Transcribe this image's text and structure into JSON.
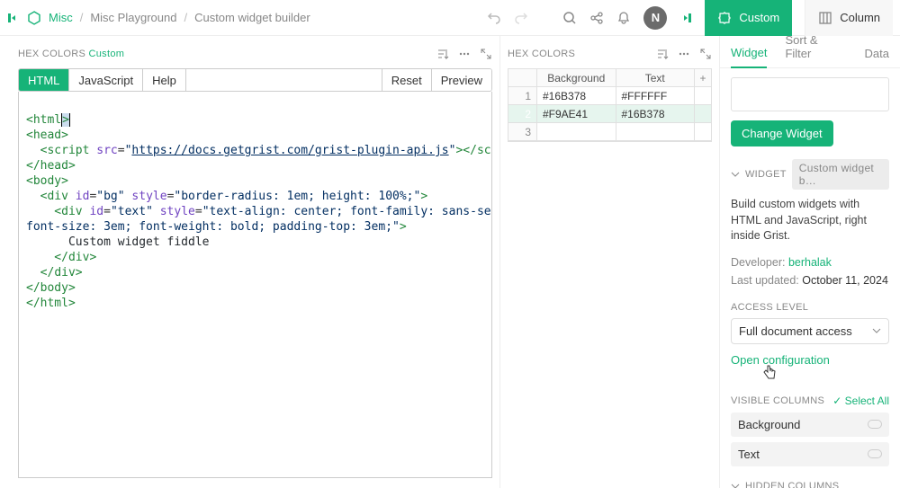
{
  "topbar": {
    "crumb1": "Misc",
    "crumb2": "Misc Playground",
    "crumb3": "Custom widget builder",
    "avatar": "N",
    "custom_label": "Custom",
    "column_label": "Column"
  },
  "editor": {
    "title_main": "HEX COLORS",
    "title_sub": "Custom",
    "tabs": {
      "html": "HTML",
      "js": "JavaScript",
      "help": "Help",
      "reset": "Reset",
      "preview": "Preview"
    },
    "code": {
      "l1a": "<",
      "l1b": "html",
      "l1c": ">",
      "l2a": "<",
      "l2b": "head",
      "l2c": ">",
      "l3a": "  <",
      "l3b": "script",
      "l3c": " ",
      "l3d": "src",
      "l3e": "=",
      "l3f": "\"",
      "l3url": "https://docs.getgrist.com/grist-plugin-api.js",
      "l3g": "\"",
      "l3h": "></",
      "l3i": "script",
      "l3j": ">",
      "l4a": "</",
      "l4b": "head",
      "l4c": ">",
      "l5a": "<",
      "l5b": "body",
      "l5c": ">",
      "l6a": "  <",
      "l6b": "div",
      "l6c": " ",
      "l6d": "id",
      "l6e": "=",
      "l6f": "\"bg\"",
      "l6g": " ",
      "l6h": "style",
      "l6i": "=",
      "l6j": "\"border-radius: 1em; height: 100%;\"",
      "l6k": ">",
      "l7a": "    <",
      "l7b": "div",
      "l7c": " ",
      "l7d": "id",
      "l7e": "=",
      "l7f": "\"text\"",
      "l7g": " ",
      "l7h": "style",
      "l7i": "=",
      "l7j": "\"text-align: center; font-family: sans-serif;",
      "l8": "font-size: 3em; font-weight: bold; padding-top: 3em;\"",
      "l8b": ">",
      "l9": "      Custom widget fiddle",
      "l10a": "    </",
      "l10b": "div",
      "l10c": ">",
      "l11a": "  </",
      "l11b": "div",
      "l11c": ">",
      "l12a": "</",
      "l12b": "body",
      "l12c": ">",
      "l13a": "</",
      "l13b": "html",
      "l13c": ">"
    }
  },
  "table": {
    "title": "HEX COLORS",
    "cols": {
      "a": "Background",
      "b": "Text"
    },
    "rows": [
      {
        "n": "1",
        "a": "#16B378",
        "b": "#FFFFFF"
      },
      {
        "n": "2",
        "a": "#F9AE41",
        "b": "#16B378"
      },
      {
        "n": "3",
        "a": "",
        "b": ""
      }
    ]
  },
  "panel": {
    "tabs": {
      "widget": "Widget",
      "sort": "Sort & Filter",
      "data": "Data"
    },
    "change": "Change Widget",
    "widget_label": "WIDGET",
    "widget_name": "Custom widget b…",
    "desc": "Build custom widgets with HTML and JavaScript, right inside Grist.",
    "dev_label": "Developer:",
    "dev_name": "berhalak",
    "upd_label": "Last updated:",
    "upd_val": "October 11, 2024",
    "access_label": "ACCESS LEVEL",
    "access_val": "Full document access",
    "open_config": "Open configuration",
    "visible_label": "VISIBLE COLUMNS",
    "select_all": "Select All",
    "col1": "Background",
    "col2": "Text",
    "hidden_label": "HIDDEN COLUMNS"
  }
}
